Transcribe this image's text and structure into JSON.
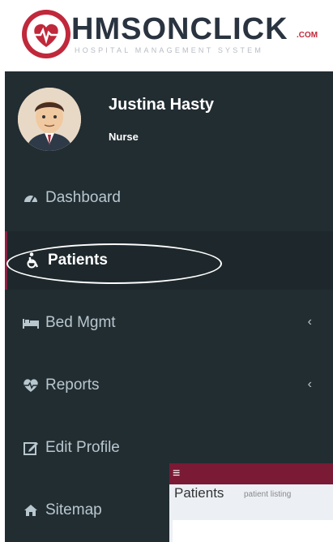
{
  "logo": {
    "text": "HMSONCLICK",
    "suffix": ".COM",
    "tagline": "HOSPITAL MANAGEMENT SYSTEM",
    "brand_color": "#c0283b"
  },
  "user": {
    "name": "Justina Hasty",
    "role": "Nurse"
  },
  "menu": {
    "dashboard": "Dashboard",
    "patients": "Patients",
    "bed_mgmt": "Bed Mgmt",
    "reports": "Reports",
    "edit_profile": "Edit Profile",
    "sitemap": "Sitemap",
    "icons": [
      "dashboard-icon",
      "wheelchair-icon",
      "bed-icon",
      "heartbeat-icon",
      "edit-icon",
      "home-icon"
    ]
  },
  "content": {
    "hamburger": "≡",
    "title": "Patients",
    "subtitle": "patient listing"
  },
  "colors": {
    "sidebar_bg": "#222d32",
    "active_bg": "#1e282c",
    "topbar_bg": "#7a1a35",
    "active_border": "#8b1e3f"
  }
}
